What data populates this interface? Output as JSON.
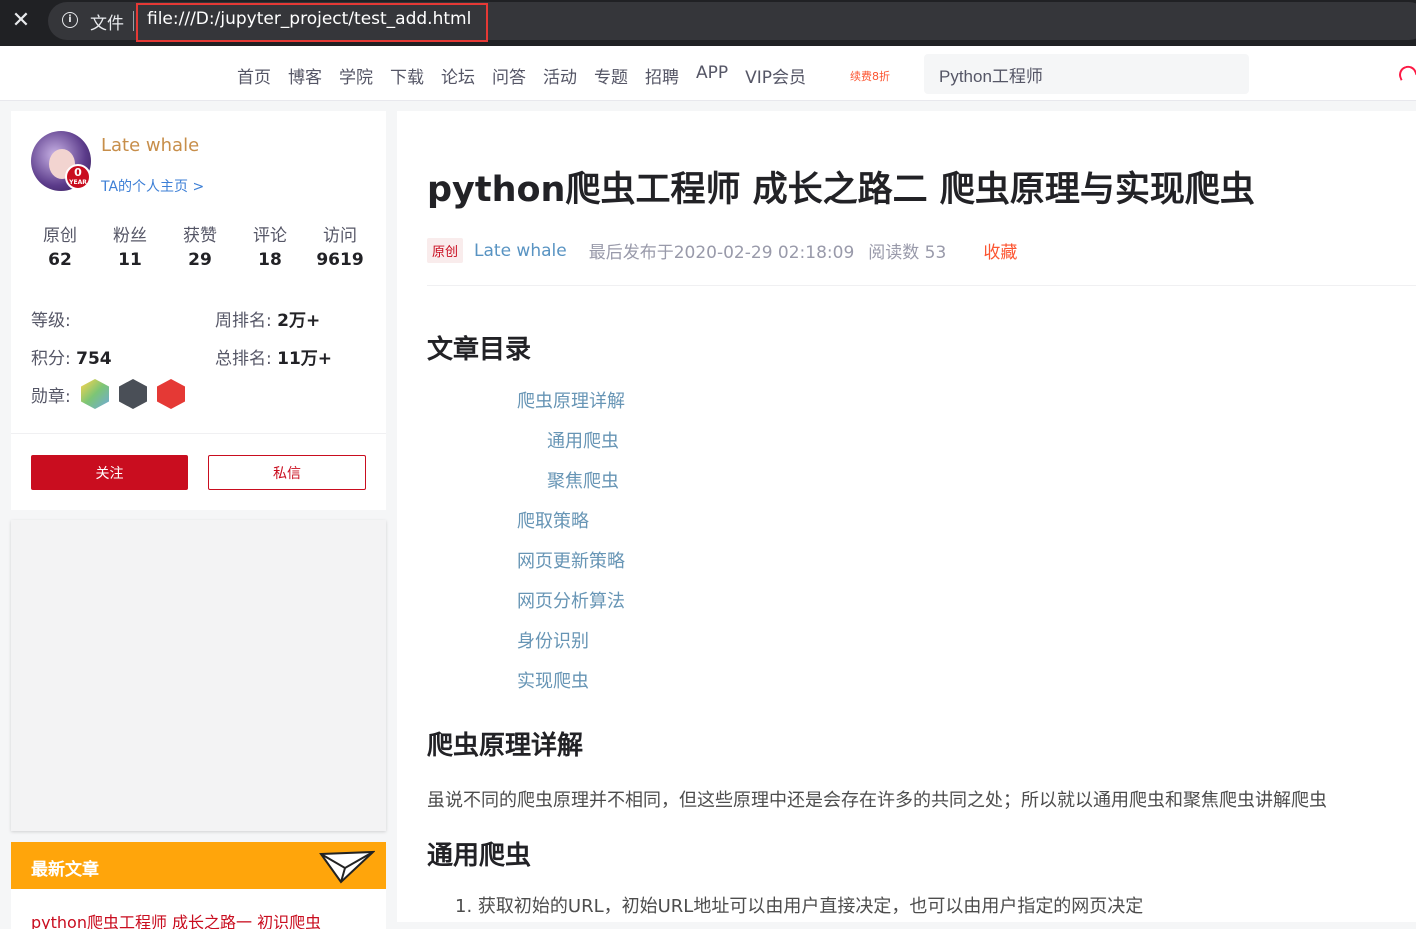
{
  "browser": {
    "file_label": "文件",
    "url": "file:///D:/jupyter_project/test_add.html"
  },
  "nav": {
    "links": [
      "首页",
      "博客",
      "学院",
      "下载",
      "论坛",
      "问答",
      "活动",
      "专题",
      "招聘",
      "APP",
      "VIP会员"
    ],
    "vip_badge": "续费8折",
    "search_value": "Python工程师"
  },
  "profile": {
    "avatar_badge": "0",
    "avatar_badge_sub": "YEAR",
    "name": "Late whale",
    "homepage_link": "TA的个人主页 >",
    "stats": [
      {
        "label": "原创",
        "value": "62"
      },
      {
        "label": "粉丝",
        "value": "11"
      },
      {
        "label": "获赞",
        "value": "29"
      },
      {
        "label": "评论",
        "value": "18"
      },
      {
        "label": "访问",
        "value": "9619"
      }
    ],
    "level_label": "等级:",
    "points_label": "积分:",
    "points_value": "754",
    "week_rank_label": "周排名:",
    "week_rank_value": "2万+",
    "total_rank_label": "总排名:",
    "total_rank_value": "11万+",
    "medals_label": "勋章:",
    "follow_button": "关注",
    "message_button": "私信"
  },
  "latest": {
    "title": "最新文章",
    "items": [
      "python爬虫工程师 成长之路一 初识爬虫"
    ]
  },
  "article": {
    "title": "python爬虫工程师 成长之路二 爬虫原理与实现爬虫",
    "tag": "原创",
    "author": "Late whale",
    "published": "最后发布于2020-02-29 02:18:09",
    "reads": "阅读数 53",
    "favorite": "收藏",
    "toc_title": "文章目录",
    "toc": [
      "爬虫原理详解",
      "通用爬虫",
      "聚焦爬虫",
      "爬取策略",
      "网页更新策略",
      "网页分析算法",
      "身份识别",
      "实现爬虫"
    ],
    "section1_title": "爬虫原理详解",
    "section1_text": "虽说不同的爬虫原理并不相同，但这些原理中还是会存在许多的共同之处；所以就以通用爬虫和聚焦爬虫讲解爬虫",
    "section2_title": "通用爬虫",
    "list_item_1": "1. 获取初始的URL，初始URL地址可以由用户直接决定，也可以由用户指定的网页决定"
  },
  "colors": {
    "brand_red": "#c90d1f",
    "accent_orange": "#ffa50b",
    "link_blue": "#6795b5"
  }
}
